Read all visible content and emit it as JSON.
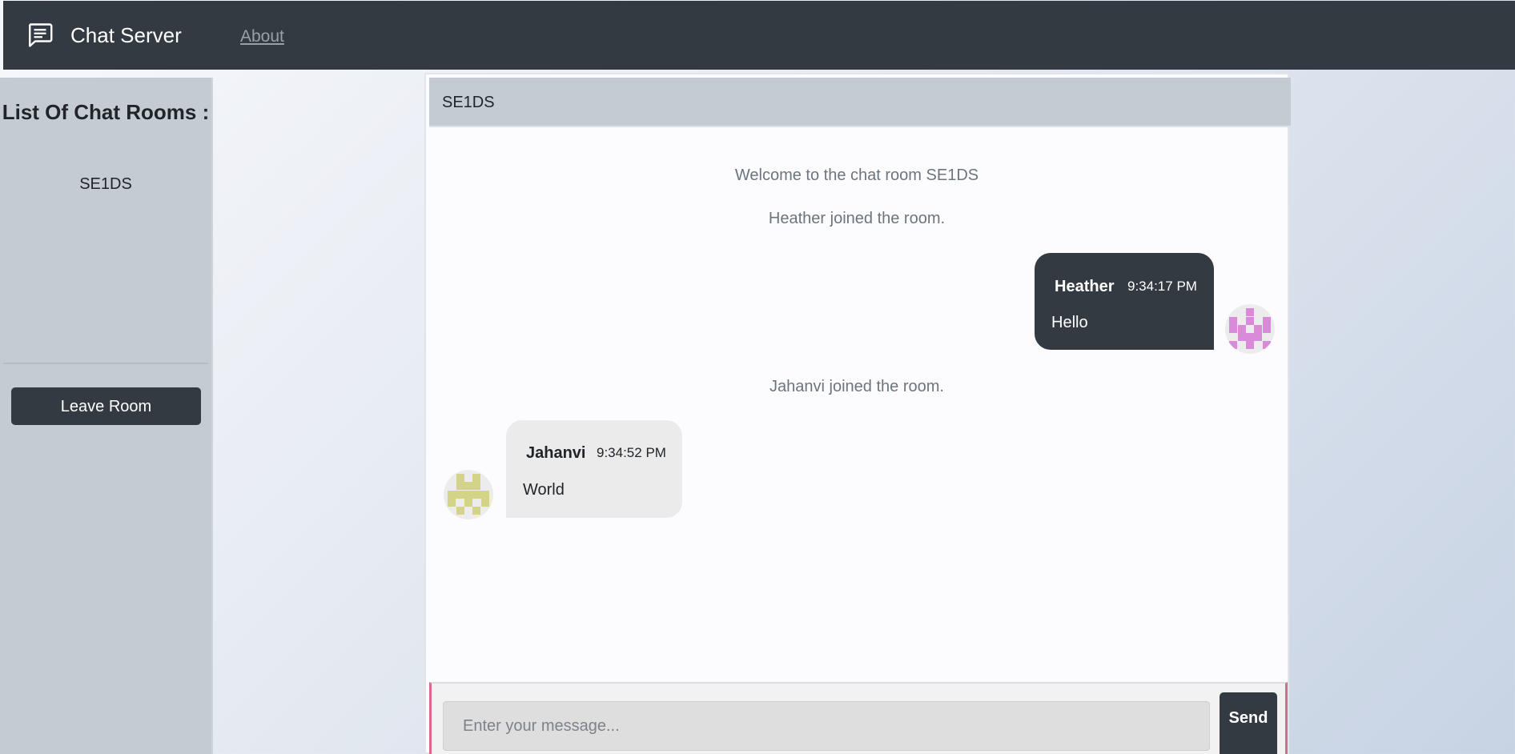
{
  "navbar": {
    "brand": "Chat Server",
    "about_link": "About",
    "icon": "chat-message-icon"
  },
  "sidebar": {
    "title": "List Of Chat Rooms :",
    "rooms": [
      {
        "name": "SE1DS"
      }
    ],
    "leave_button": "Leave Room"
  },
  "chat": {
    "room_title": "SE1DS",
    "system_messages": [
      "Welcome to the chat room SE1DS",
      "Heather joined the room.",
      "Jahanvi joined the room."
    ],
    "messages": [
      {
        "user": "Heather",
        "time": "9:34:17 PM",
        "text": "Hello",
        "avatar_color": "#d98ad9"
      },
      {
        "user": "Jahanvi",
        "time": "9:34:52 PM",
        "text": "World",
        "avatar_color": "#d3d487"
      }
    ]
  },
  "composer": {
    "placeholder": "Enter your message...",
    "send_label": "Send"
  },
  "colors": {
    "navbar": "#343a42",
    "sidebar": "#c5cbd2",
    "outgoing_bubble": "#343a42",
    "incoming_bubble": "#ebebeb",
    "composer_accent": "#d56a90"
  }
}
